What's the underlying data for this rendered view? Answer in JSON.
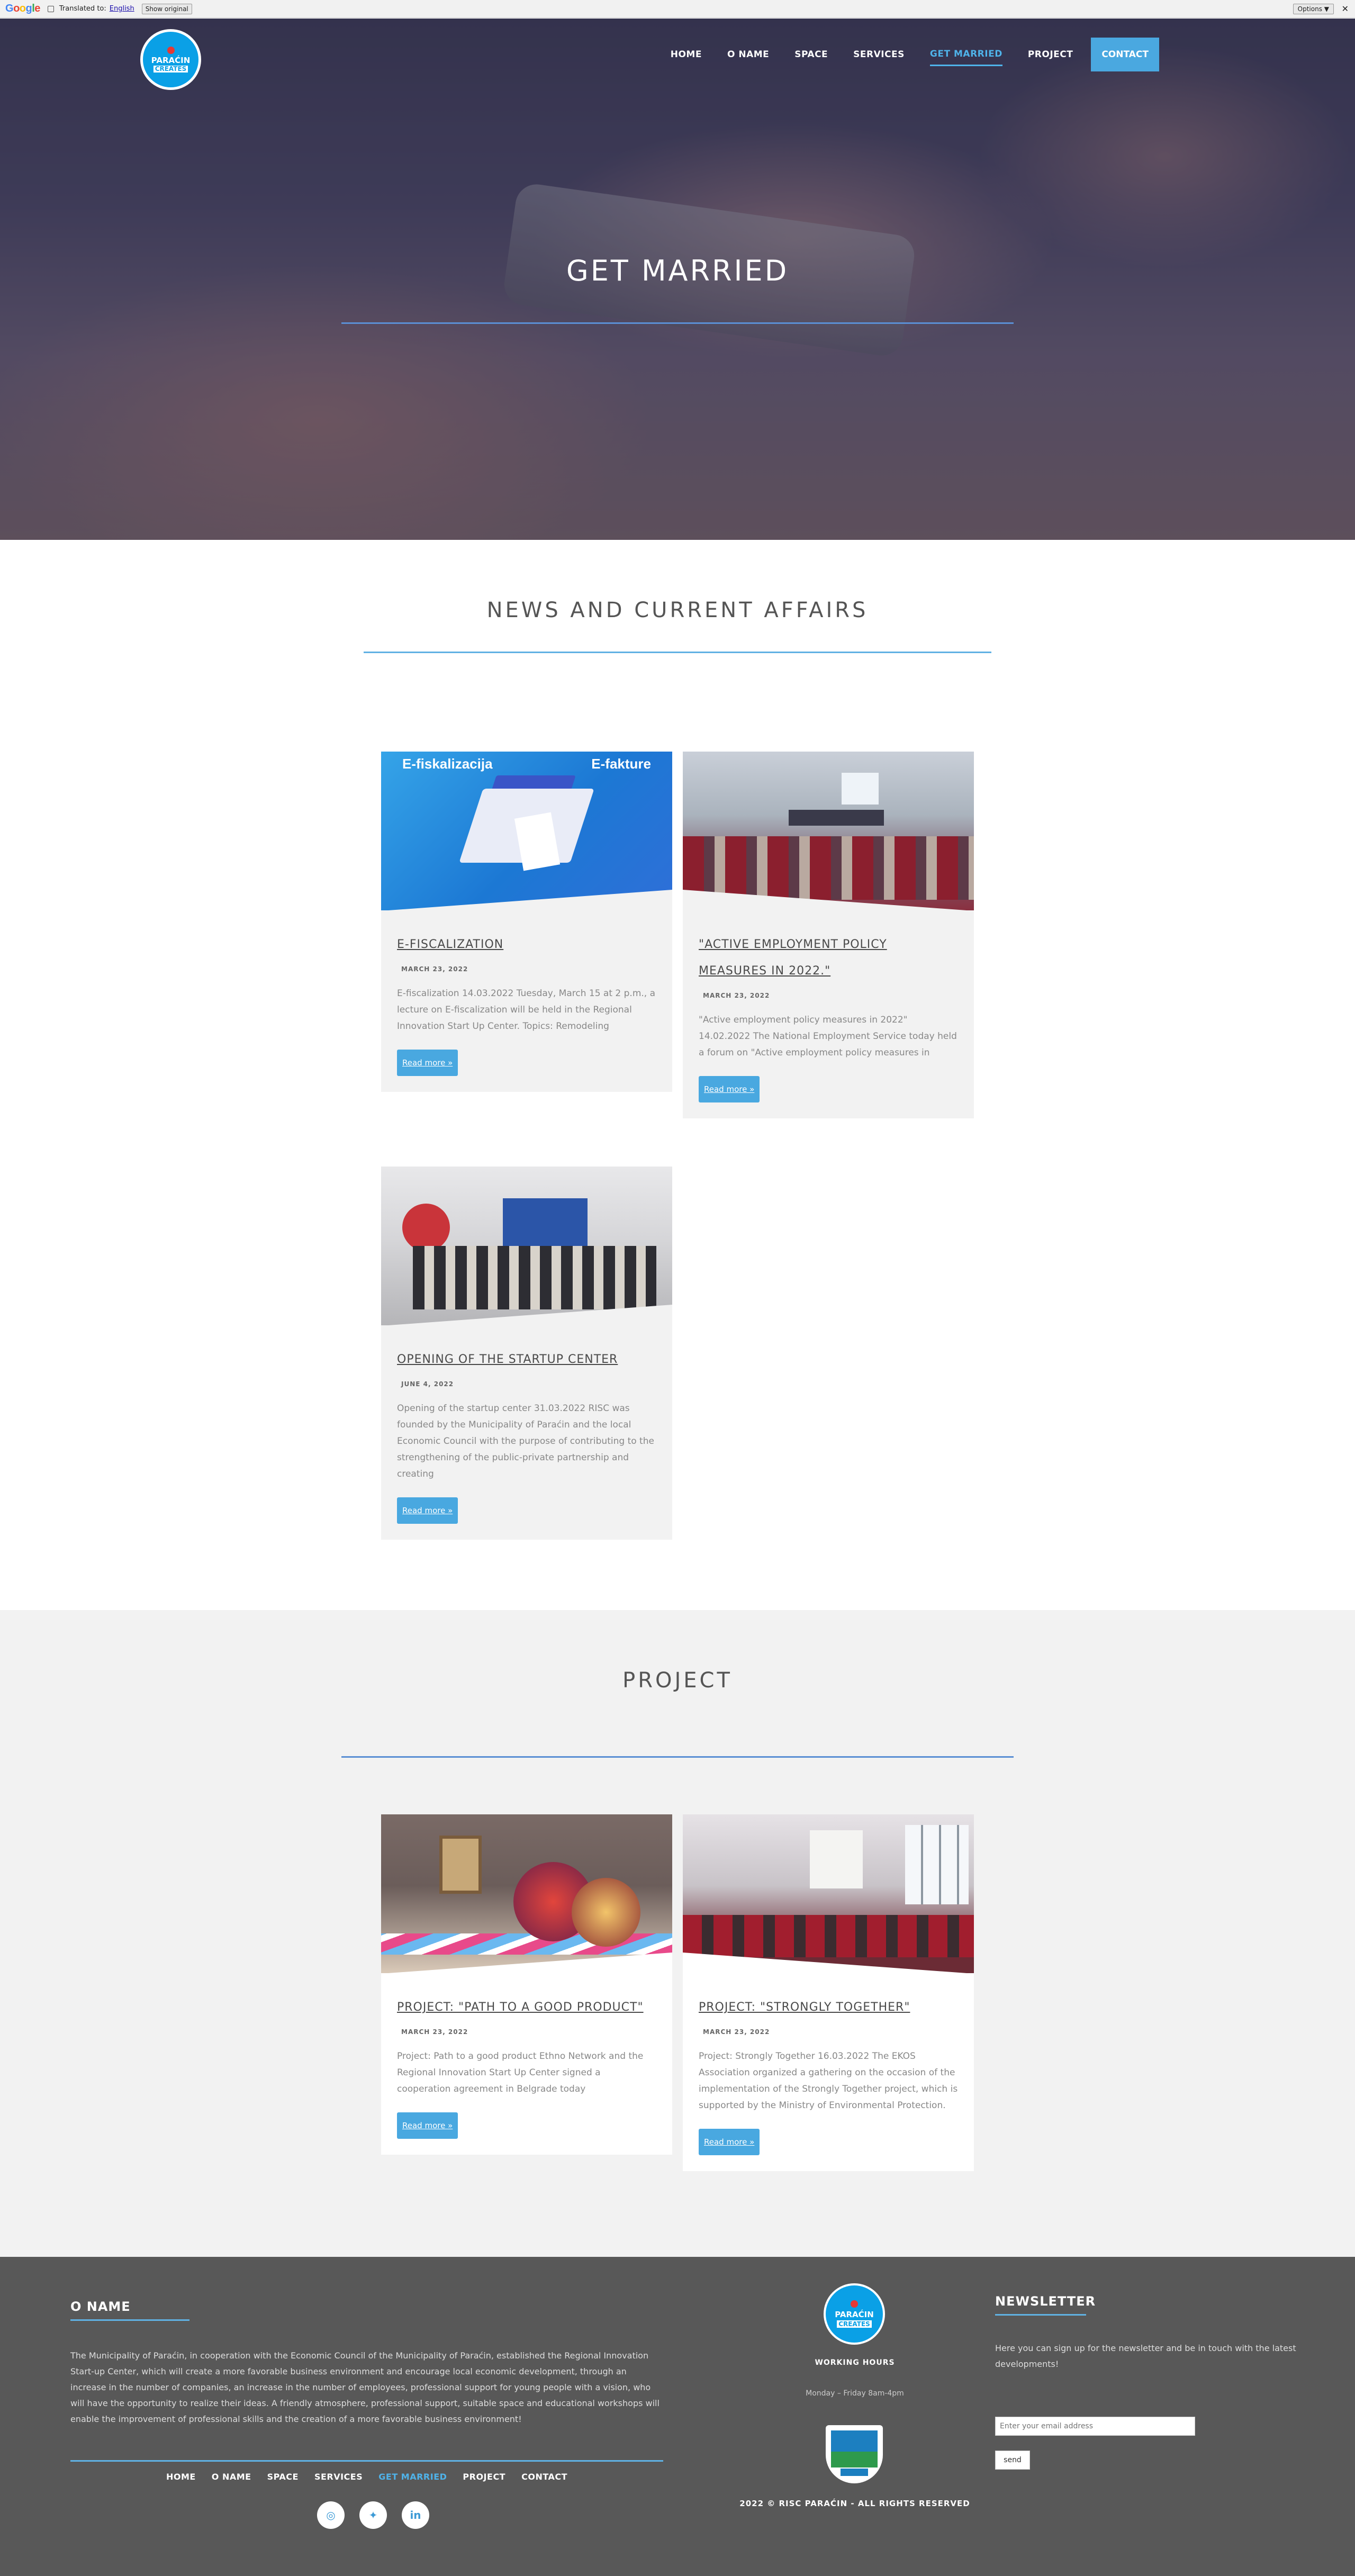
{
  "translate_bar": {
    "logo": "Google",
    "translated_to": "Translated to:",
    "language": "English",
    "show_original": "Show original",
    "options": "Options ▼",
    "close": "✕"
  },
  "site": {
    "logo_line1": "PARAĆIN",
    "logo_line2": "CREATES"
  },
  "nav": {
    "items": [
      "HOME",
      "O NAME",
      "SPACE",
      "SERVICES",
      "GET MARRIED",
      "PROJECT"
    ],
    "active_index": 4,
    "contact": "CONTACT"
  },
  "hero": {
    "title": "GET MARRIED"
  },
  "news": {
    "title": "NEWS AND CURRENT AFFAIRS",
    "cards": [
      {
        "title": "E-FISCALIZATION",
        "date": "MARCH 23, 2022",
        "excerpt": "E-fiscalization 14.03.2022 Tuesday, March 15 at 2 p.m., a lecture on E-fiscalization will be held in the Regional Innovation Start Up Center. Topics: Remodeling",
        "more": "Read more »",
        "image_text_left": "E-fiskalizacija",
        "image_text_right": "E-fakture"
      },
      {
        "title": "\"ACTIVE EMPLOYMENT POLICY MEASURES IN 2022.\"",
        "date": "MARCH 23, 2022",
        "excerpt": "\"Active employment policy measures in 2022\" 14.02.2022 The National Employment Service today held a forum on \"Active employment policy measures in",
        "more": "Read more »"
      },
      {
        "title": "OPENING OF THE STARTUP CENTER",
        "date": "JUNE 4, 2022",
        "excerpt": "Opening of the startup center 31.03.2022 RISC was founded by the Municipality of Paraćin and the local Economic Council with the purpose of contributing to the strengthening of the public-private partnership and creating",
        "more": "Read more »"
      }
    ]
  },
  "projects": {
    "title": "PROJECT",
    "cards": [
      {
        "title": "PROJECT: \"PATH TO A GOOD PRODUCT\"",
        "date": "MARCH 23, 2022",
        "excerpt": "Project: Path to a good product Ethno Network and the Regional Innovation Start Up Center signed a cooperation agreement in Belgrade today",
        "more": "Read more »"
      },
      {
        "title": "PROJECT: \"STRONGLY TOGETHER\"",
        "date": "MARCH 23, 2022",
        "excerpt": "Project: Strongly Together 16.03.2022 The EKOS Association organized a gathering on the occasion of the implementation of the Strongly Together project, which is supported by the Ministry of Environmental Protection.",
        "more": "Read more »"
      }
    ]
  },
  "footer": {
    "o_name_title": "O NAME",
    "about": "The Municipality of Paraćin, in cooperation with the Economic Council of the Municipality of Paraćin, established the Regional Innovation Start-up Center, which will create a more favorable business environment and encourage local economic development, through an increase in the number of companies, an increase in the number of employees, professional support for young people with a vision, who will have the opportunity to realize their ideas. A friendly atmosphere, professional support, suitable space and educational workshops will enable the improvement of professional skills and the creation of a more favorable business environment!",
    "nav": [
      "HOME",
      "O NAME",
      "SPACE",
      "SERVICES",
      "GET MARRIED",
      "PROJECT",
      "CONTACT"
    ],
    "nav_active_index": 4,
    "social": [
      {
        "icon": "instagram-icon",
        "glyph": "◎"
      },
      {
        "icon": "twitter-icon",
        "glyph": "✦"
      },
      {
        "icon": "linkedin-icon",
        "glyph": "in"
      }
    ],
    "working_hours_title": "WORKING HOURS",
    "working_hours": "Monday – Friday 8am-4pm",
    "copyright": "2022 © RISC PARAĆIN - ALL RIGHTS RESERVED",
    "newsletter_title": "NEWSLETTER",
    "newsletter_text": "Here you can sign up for the newsletter and be in touch with the latest developments!",
    "email_placeholder": "Enter your email address",
    "send": "send"
  },
  "colors": {
    "accent": "#49a8e0",
    "footer_bg": "#585858",
    "section_bg": "#f2f2f2"
  }
}
